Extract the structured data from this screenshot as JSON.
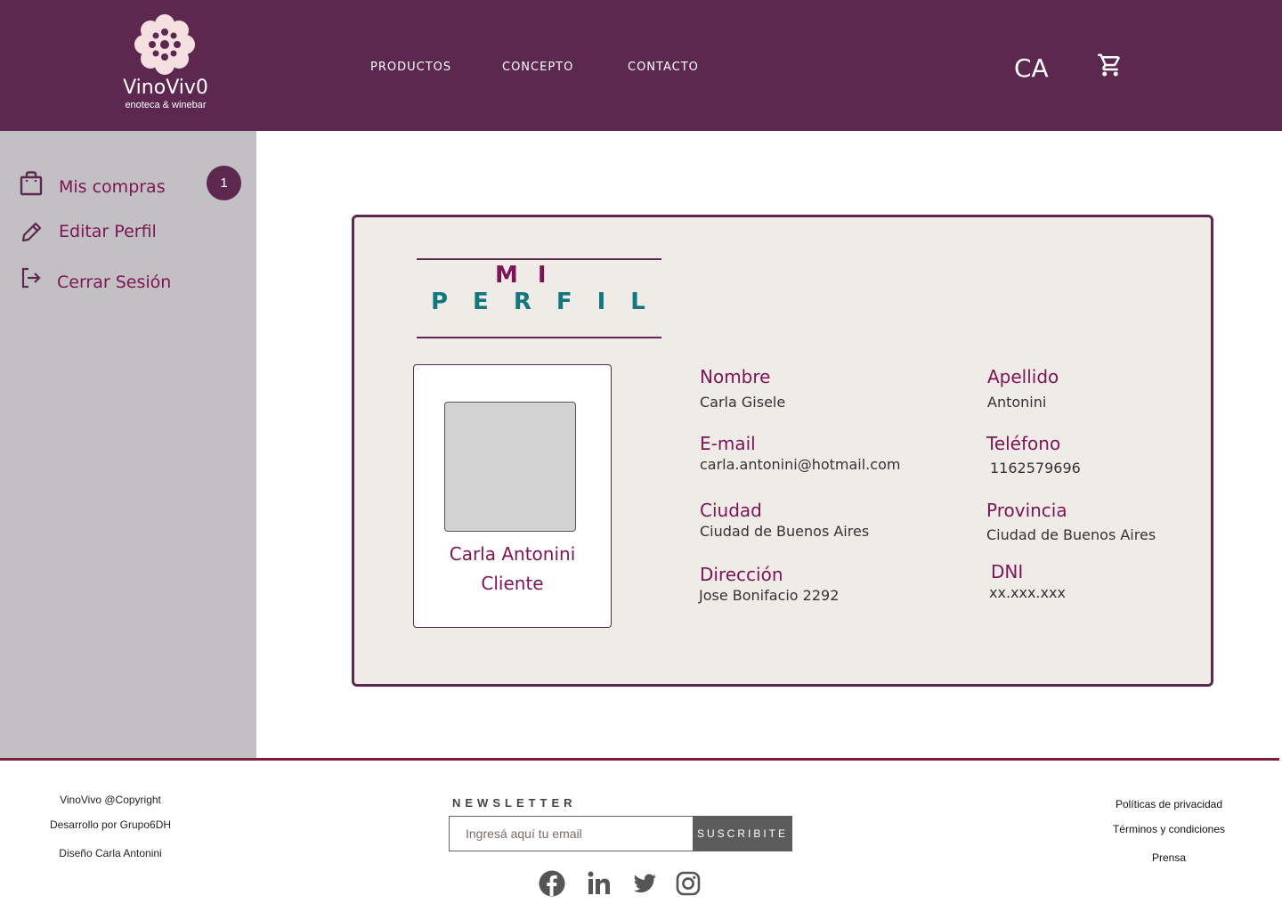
{
  "brand": {
    "name": "VinoViv0",
    "subtitle": "enoteca & winebar"
  },
  "nav": {
    "items": [
      {
        "label": "PRODUCTOS"
      },
      {
        "label": "CONCEPTO"
      },
      {
        "label": "CONTACTO"
      }
    ]
  },
  "user": {
    "initials": "CA"
  },
  "sidebar": {
    "items": [
      {
        "label": "Mis compras",
        "icon": "shopping-bag-icon",
        "badge": "1"
      },
      {
        "label": "Editar Perfil",
        "icon": "pencil-icon"
      },
      {
        "label": "Cerrar Sesión",
        "icon": "logout-icon"
      }
    ]
  },
  "profile": {
    "title_line1": "MI",
    "title_line2": "PERFIL",
    "name": "Carla Antonini",
    "role": "Cliente",
    "fields": {
      "nombre": {
        "label": "Nombre",
        "value": "Carla Gisele"
      },
      "apellido": {
        "label": "Apellido",
        "value": "Antonini"
      },
      "email": {
        "label": "E-mail",
        "value": "carla.antonini@hotmail.com"
      },
      "telefono": {
        "label": "Teléfono",
        "value": "1162579696"
      },
      "ciudad": {
        "label": "Ciudad",
        "value": "Ciudad de Buenos Aires"
      },
      "provincia": {
        "label": "Provincia",
        "value": "Ciudad de Buenos Aires"
      },
      "direccion": {
        "label": "Dirección",
        "value": "Jose Bonifacio 2292"
      },
      "dni": {
        "label": "DNI",
        "value": "xx.xxx.xxx"
      }
    }
  },
  "footer": {
    "left": [
      "VinoVivo @Copyright",
      "Desarrollo por Grupo6DH",
      "Diseño Carla Antonini"
    ],
    "newsletter": {
      "title": "NEWSLETTER",
      "placeholder": "Ingresá aquí tu email",
      "button": "SUSCRIBITE"
    },
    "social": [
      "facebook-icon",
      "linkedin-icon",
      "twitter-icon",
      "instagram-icon"
    ],
    "right": [
      "Políticas de privacidad",
      "Términos y condiciones",
      "Prensa"
    ]
  },
  "colors": {
    "header": "#5c2850",
    "accent": "#7d1457",
    "teal": "#14767e",
    "sidebar": "#c2c0c2",
    "card": "#efebe7"
  }
}
